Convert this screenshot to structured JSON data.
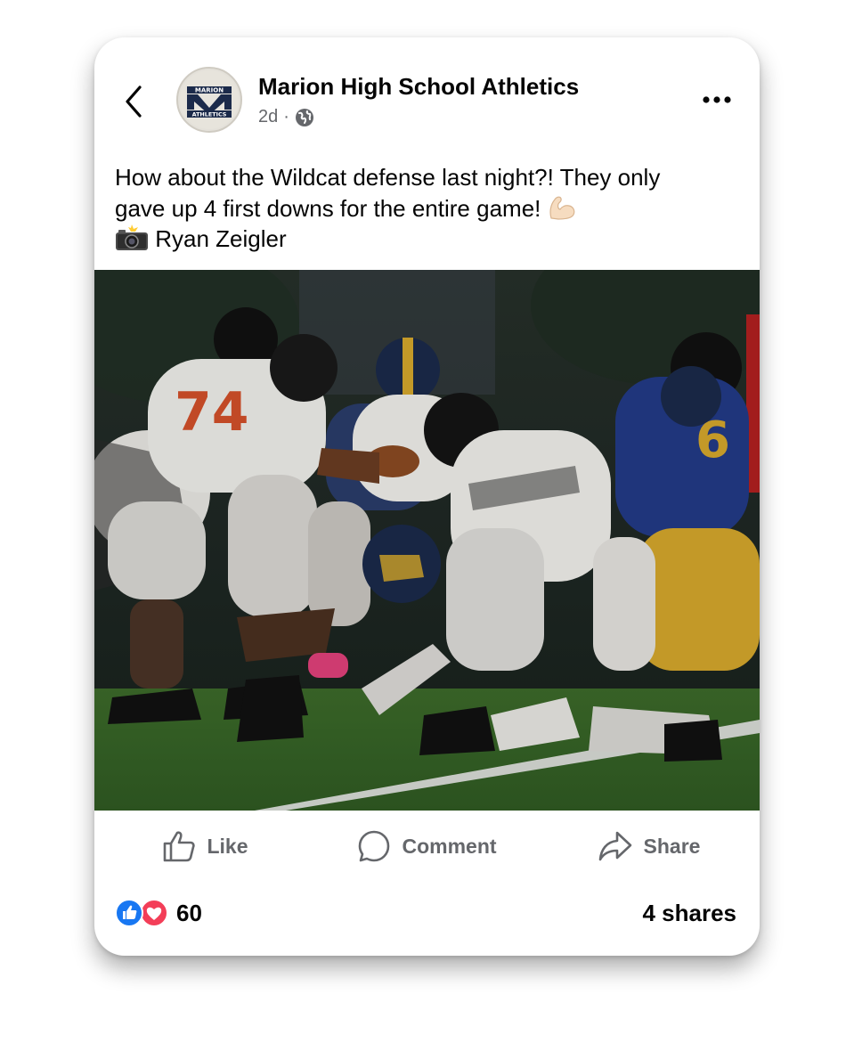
{
  "post": {
    "page_name": "Marion High School Athletics",
    "time": "2d",
    "separator": "·",
    "text_line1": "How about the Wildcat defense last night?! They only",
    "text_line2": "gave up 4 first downs for the entire game!",
    "photo_credit": "Ryan Zeigler",
    "reactions_count": "60",
    "shares": "4 shares"
  },
  "avatar": {
    "top_text": "MARION",
    "letter": "M",
    "bottom_text": "ATHLETICS"
  },
  "actions": {
    "like": "Like",
    "comment": "Comment",
    "share": "Share"
  },
  "icons": {
    "back": "chevron-left-icon",
    "more": "more-horizontal-icon",
    "audience": "globe-icon",
    "like": "thumbs-up-icon",
    "comment": "speech-bubble-icon",
    "share": "share-arrow-icon",
    "reaction_like": "like-reaction-icon",
    "reaction_love": "love-reaction-icon",
    "emoji_arm": "flexed-biceps-emoji",
    "emoji_camera": "camera-flash-emoji"
  },
  "colors": {
    "text_primary": "#050505",
    "text_secondary": "#65676b",
    "like_blue": "#1877f2",
    "love_red": "#f33e58",
    "navy": "#1b2a4a",
    "gold": "#d4a72c"
  }
}
